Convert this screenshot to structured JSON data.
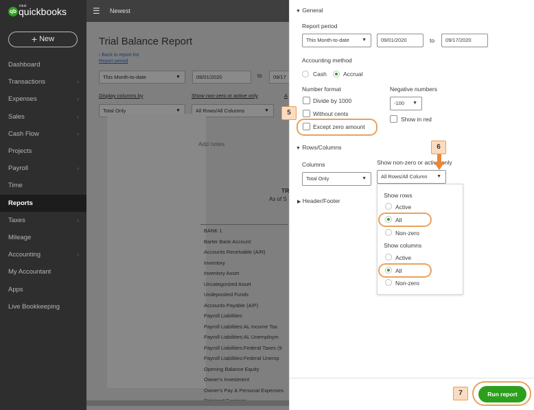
{
  "sidebar": {
    "brand_small": "intuit",
    "brand": "quickbooks",
    "brand_mark": "qb",
    "new_label": "New",
    "items": [
      {
        "label": "Dashboard",
        "chevron": false
      },
      {
        "label": "Transactions",
        "chevron": true
      },
      {
        "label": "Expenses",
        "chevron": true
      },
      {
        "label": "Sales",
        "chevron": true
      },
      {
        "label": "Cash Flow",
        "chevron": true
      },
      {
        "label": "Projects",
        "chevron": false
      },
      {
        "label": "Payroll",
        "chevron": true
      },
      {
        "label": "Time",
        "chevron": false
      },
      {
        "label": "Reports",
        "chevron": false,
        "active": true
      },
      {
        "label": "Taxes",
        "chevron": true
      },
      {
        "label": "Mileage",
        "chevron": false
      },
      {
        "label": "Accounting",
        "chevron": true
      },
      {
        "label": "My Accountant",
        "chevron": false
      },
      {
        "label": "Apps",
        "chevron": false
      },
      {
        "label": "Live Bookkeeping",
        "chevron": false
      }
    ]
  },
  "topbar": {
    "title": "Newest"
  },
  "report": {
    "title": "Trial Balance Report",
    "back_link": "Back to report list",
    "report_period_label": "Report period",
    "period_value": "This Month-to-date",
    "start_date": "09/01/2020",
    "to": "to",
    "end_date_partial": "09/17",
    "display_columns_label": "Display columns by",
    "display_columns_value": "Total Only",
    "show_nonzero_label": "Show non-zero or active only",
    "show_nonzero_value": "All Rows/All Columns",
    "add_notes": "Add notes",
    "header_partial": "TR",
    "subheader_partial": "As of S",
    "accounts": [
      "BANK 1",
      "Barter Bank Account",
      "Accounts Receivable (A/R)",
      "Inventory",
      "Inventory Asset",
      "Uncategorized Asset",
      "Undeposited Funds",
      "Accounts Payable (A/P)",
      "Payroll Liabilities",
      "Payroll Liabilities:AL Income Tax",
      "Payroll Liabilities:AL Unemploym",
      "Payroll Liabilities:Federal Taxes (9",
      "Payroll Liabilities:Federal Unemp",
      "Opening Balance Equity",
      "Owner's Investment",
      "Owner's Pay & Personal Expenses",
      "Retained Earnings"
    ]
  },
  "panel": {
    "general_label": "General",
    "report_period_label": "Report period",
    "period_value": "This Month-to-date",
    "start_date": "09/01/2020",
    "to": "to",
    "end_date": "09/17/2020",
    "accounting_method_label": "Accounting method",
    "cash_label": "Cash",
    "accrual_label": "Accrual",
    "number_format_label": "Number format",
    "divide_label": "Divide by 1000",
    "without_cents_label": "Without cents",
    "except_zero_label": "Except zero amount",
    "negative_numbers_label": "Negative numbers",
    "negative_value": "-100",
    "show_red_label": "Show in red",
    "rows_columns_label": "Rows/Columns",
    "columns_label": "Columns",
    "columns_value": "Total Only",
    "show_nonzero_label": "Show non-zero or active only",
    "show_nonzero_value": "All Rows/All Column",
    "header_footer_label": "Header/Footer",
    "dropdown": {
      "show_rows_label": "Show rows",
      "rows_options": [
        "Active",
        "All",
        "Non-zero"
      ],
      "rows_selected": "All",
      "show_columns_label": "Show columns",
      "columns_options": [
        "Active",
        "All",
        "Non-zero"
      ],
      "columns_selected": "All"
    },
    "run_report_label": "Run report"
  },
  "callouts": {
    "step5": "5",
    "step6": "6",
    "step7": "7"
  },
  "colors": {
    "accent": "#2ca01c",
    "highlight": "#e8a15b",
    "callout_fill": "#fcdcc0",
    "sidebar": "#2e2e2e"
  }
}
